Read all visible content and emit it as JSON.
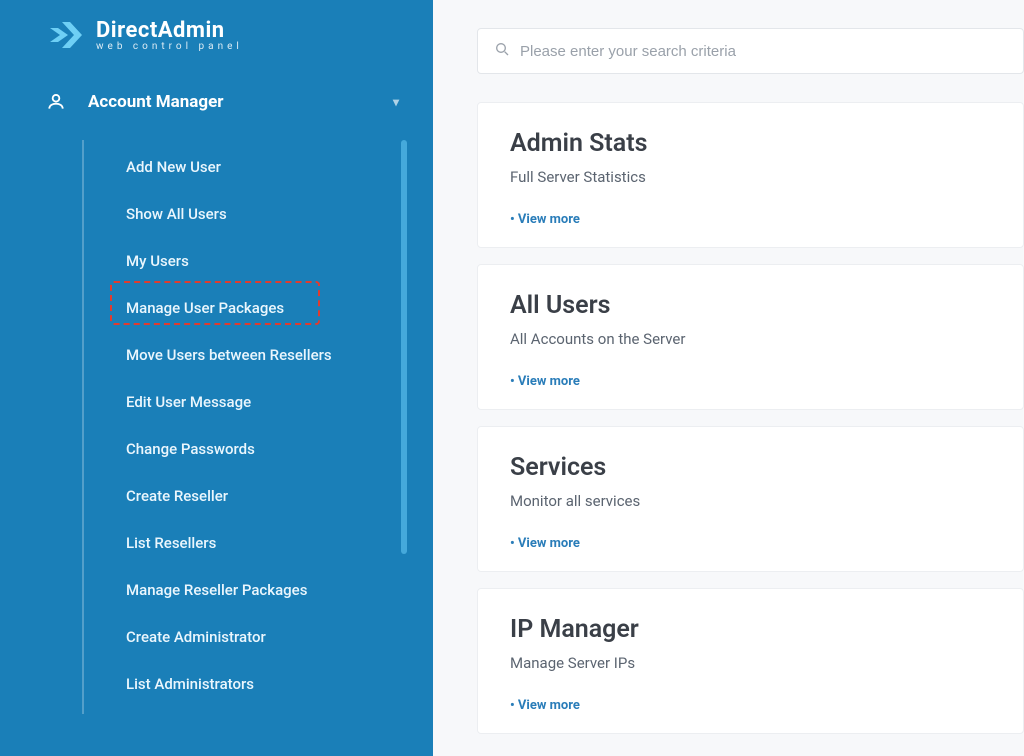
{
  "brand": {
    "title": "DirectAdmin",
    "subtitle": "web control panel"
  },
  "nav": {
    "section_label": "Account Manager",
    "items": [
      {
        "label": "Add New User"
      },
      {
        "label": "Show All Users"
      },
      {
        "label": "My Users"
      },
      {
        "label": "Manage User Packages",
        "highlighted": true
      },
      {
        "label": "Move Users between Resellers"
      },
      {
        "label": "Edit User Message"
      },
      {
        "label": "Change Passwords"
      },
      {
        "label": "Create Reseller"
      },
      {
        "label": "List Resellers"
      },
      {
        "label": "Manage Reseller Packages"
      },
      {
        "label": "Create Administrator"
      },
      {
        "label": "List Administrators"
      }
    ]
  },
  "search": {
    "placeholder": "Please enter your search criteria"
  },
  "cards": [
    {
      "title": "Admin Stats",
      "subtitle": "Full Server Statistics",
      "link": "View more"
    },
    {
      "title": "All Users",
      "subtitle": "All Accounts on the Server",
      "link": "View more"
    },
    {
      "title": "Services",
      "subtitle": "Monitor all services",
      "link": "View more"
    },
    {
      "title": "IP Manager",
      "subtitle": "Manage Server IPs",
      "link": "View more"
    }
  ]
}
